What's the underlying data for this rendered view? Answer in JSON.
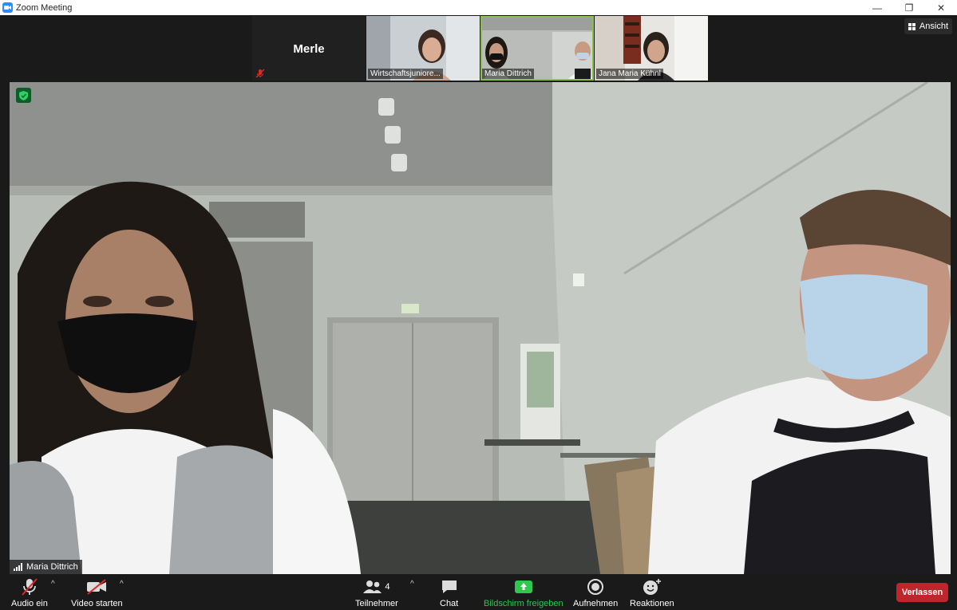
{
  "window": {
    "title": "Zoom Meeting",
    "minimize": "—",
    "restore": "❐",
    "close": "✕"
  },
  "gallery": {
    "name_tile": {
      "name": "Merle"
    },
    "thumbnails": [
      {
        "label": "Wirtschaftsjuniore..."
      },
      {
        "label": "Maria Dittrich",
        "active": true
      },
      {
        "label": "Jana Maria Kühnl"
      }
    ]
  },
  "view_button": {
    "label": "Ansicht"
  },
  "main": {
    "speaker": "Maria Dittrich"
  },
  "toolbar": {
    "audio": {
      "label": "Audio ein"
    },
    "video": {
      "label": "Video starten"
    },
    "participants": {
      "label": "Teilnehmer",
      "count": "4"
    },
    "chat": {
      "label": "Chat"
    },
    "share": {
      "label": "Bildschirm freigeben"
    },
    "record": {
      "label": "Aufnehmen"
    },
    "reactions": {
      "label": "Reaktionen"
    },
    "leave": {
      "label": "Verlassen"
    }
  },
  "colors": {
    "accent_green": "#31c64d",
    "leave_red": "#c0252c",
    "zoom_blue": "#2d8cff",
    "active_border": "#8bc34a"
  }
}
